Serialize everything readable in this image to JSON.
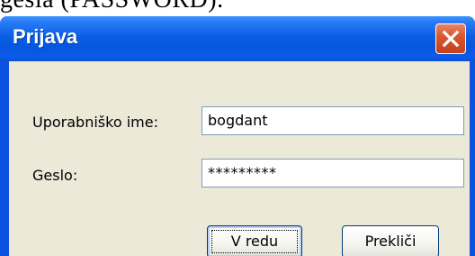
{
  "background": {
    "cut_off_text": "gesla (PASSWORD)."
  },
  "window": {
    "title": "Prijava",
    "close_icon": "close-icon",
    "titlebar_color": "#0a5ee5",
    "client_color": "#ece9d8"
  },
  "form": {
    "username": {
      "label": "Uporabniško ime:",
      "value": "bogdant"
    },
    "password": {
      "label": "Geslo:",
      "value": "*********"
    }
  },
  "buttons": {
    "ok_label": "V redu",
    "cancel_label": "Prekliči"
  }
}
